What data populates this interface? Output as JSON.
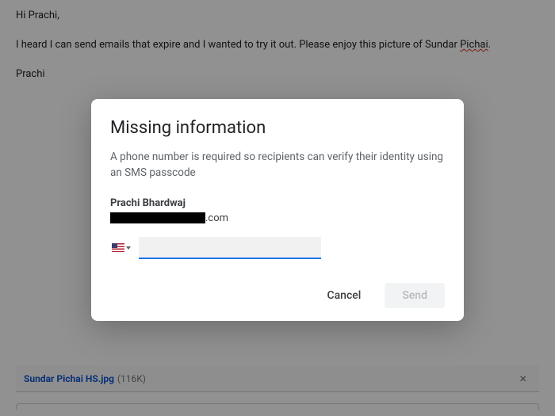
{
  "email": {
    "greeting": "Hi Prachi,",
    "body": "I heard I can send emails that expire and I wanted to try it out. Please enjoy this picture of Sundar ",
    "body_underlined": "Pichai",
    "body_end": ".",
    "signature": "Prachi"
  },
  "attachment": {
    "name": "Sundar Pichai HS.jpg",
    "size": "(116K)"
  },
  "dialog": {
    "title": "Missing information",
    "description": "A phone number is required so recipients can verify their identity using an SMS passcode",
    "recipient_name": "Prachi Bhardwaj",
    "email_suffix": ".com",
    "phone_value": "",
    "cancel_label": "Cancel",
    "send_label": "Send"
  }
}
